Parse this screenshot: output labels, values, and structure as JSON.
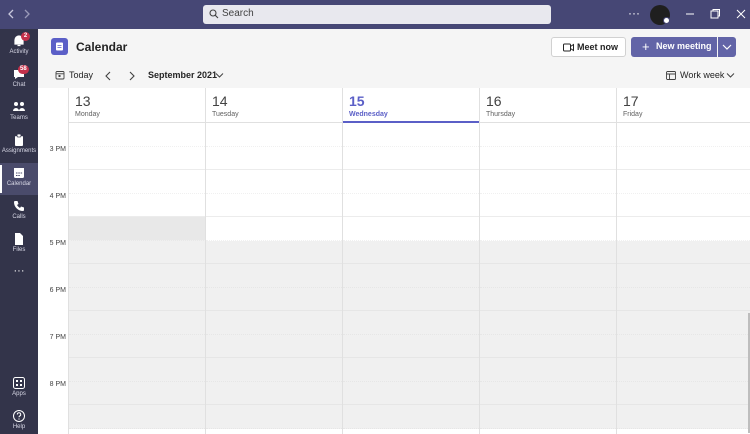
{
  "titlebar": {
    "search_placeholder": "Search",
    "more_label": "···",
    "accent": "#464775"
  },
  "rail": {
    "items": [
      {
        "label": "Activity",
        "icon": "bell-icon",
        "badge": "2"
      },
      {
        "label": "Chat",
        "icon": "chat-icon",
        "badge": "58"
      },
      {
        "label": "Teams",
        "icon": "teams-icon"
      },
      {
        "label": "Assignments",
        "icon": "assignments-icon"
      },
      {
        "label": "Calendar",
        "icon": "calendar-icon",
        "active": true
      },
      {
        "label": "Calls",
        "icon": "phone-icon"
      },
      {
        "label": "Files",
        "icon": "file-icon"
      },
      {
        "label": "···",
        "icon": "more-icon"
      }
    ],
    "bottom": [
      {
        "label": "Apps",
        "icon": "apps-icon"
      },
      {
        "label": "Help",
        "icon": "help-icon"
      }
    ]
  },
  "header": {
    "title": "Calendar",
    "meet_now": "Meet now",
    "new_meeting": "New meeting",
    "brand_color": "#6264a7"
  },
  "toolbar": {
    "today": "Today",
    "month": "September 2021",
    "view": "Work week"
  },
  "days": [
    {
      "num": "13",
      "name": "Monday"
    },
    {
      "num": "14",
      "name": "Tuesday"
    },
    {
      "num": "15",
      "name": "Wednesday",
      "today": true
    },
    {
      "num": "16",
      "name": "Thursday"
    },
    {
      "num": "17",
      "name": "Friday"
    }
  ],
  "times": [
    "3 PM",
    "4 PM",
    "5 PM",
    "6 PM",
    "7 PM",
    "8 PM"
  ]
}
